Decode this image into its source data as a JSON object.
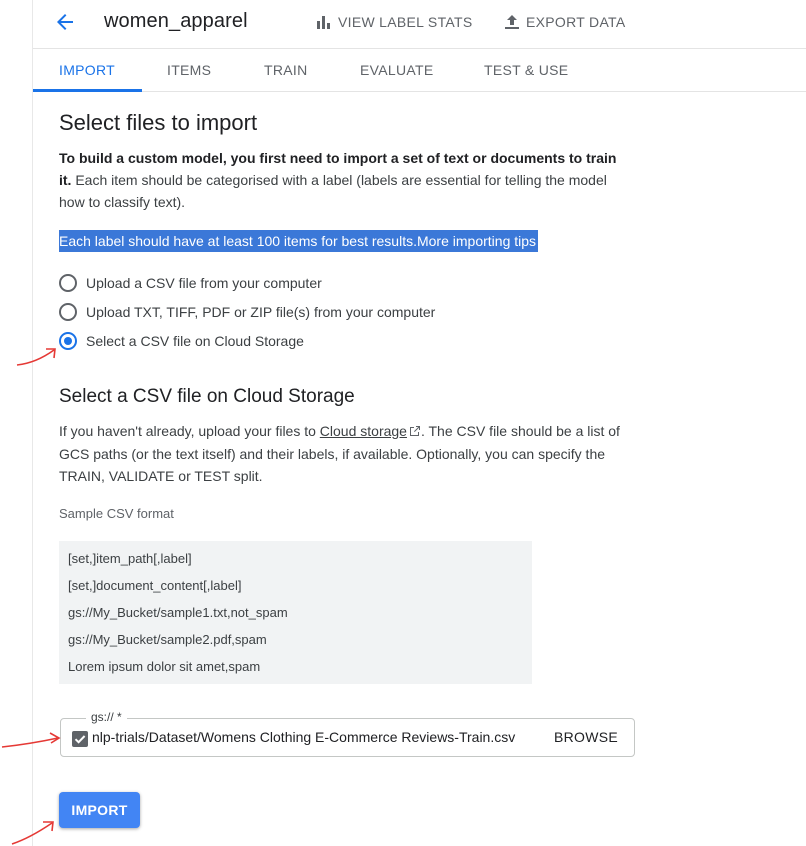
{
  "header": {
    "title": "women_apparel",
    "back_icon": "arrow-back-icon",
    "actions": [
      {
        "label": "VIEW LABEL STATS",
        "icon": "bar-chart-icon"
      },
      {
        "label": "EXPORT DATA",
        "icon": "upload-icon"
      }
    ]
  },
  "tabs": [
    {
      "label": "IMPORT",
      "active": true
    },
    {
      "label": "ITEMS",
      "active": false
    },
    {
      "label": "TRAIN",
      "active": false
    },
    {
      "label": "EVALUATE",
      "active": false
    },
    {
      "label": "TEST & USE",
      "active": false
    }
  ],
  "main": {
    "heading": "Select files to import",
    "intro_bold": "To build a custom model, you first need to import a set of text or documents to train it.",
    "intro_rest": "Each item should be categorised with a label (labels are essential for telling the model how to classify text).",
    "highlight_text": "Each label should have at least 100 items for best results.",
    "highlight_link": "More importing tips",
    "options": [
      {
        "label": "Upload a CSV file from your computer",
        "selected": false
      },
      {
        "label": "Upload TXT, TIFF, PDF or ZIP file(s) from your computer",
        "selected": false
      },
      {
        "label": "Select a CSV file on Cloud Storage",
        "selected": true
      }
    ]
  },
  "cloud": {
    "heading": "Select a CSV file on Cloud Storage",
    "desc_before": "If you haven't already, upload your files to ",
    "desc_link": "Cloud storage",
    "desc_after": ". The CSV file should be a list of GCS paths (or the text itself) and their labels, if available. Optionally, you can specify the TRAIN, VALIDATE or TEST split.",
    "sample_label": "Sample CSV format",
    "sample_lines": [
      "[set,]item_path[,label]",
      "[set,]document_content[,label]",
      "gs://My_Bucket/sample1.txt,not_spam",
      "gs://My_Bucket/sample2.pdf,spam",
      "Lorem ipsum dolor sit amet,spam"
    ]
  },
  "field": {
    "label": "gs:// *",
    "value": "nlp-trials/Dataset/Womens Clothing E-Commerce Reviews-Train.csv",
    "browse_label": "BROWSE"
  },
  "import_button": "IMPORT",
  "colors": {
    "accent": "#1a73e8",
    "button": "#4285f4",
    "highlight": "#3b78d8",
    "annotation": "#e53935"
  }
}
